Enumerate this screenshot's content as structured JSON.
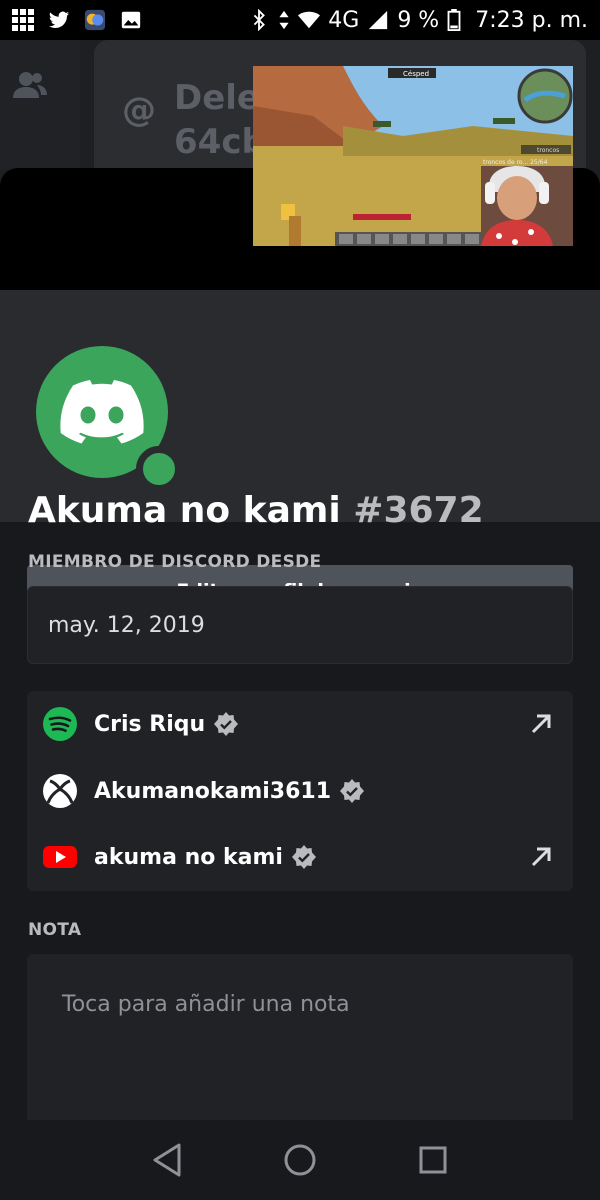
{
  "status_bar": {
    "network": "4G",
    "battery": "9 %",
    "time": "7:23 p. m."
  },
  "background": {
    "dm_title": "Delet\n64cb"
  },
  "profile": {
    "username": "Akuma no kami",
    "discriminator": "#3672",
    "edit_button_label": "Editar perfil de usuario",
    "status": "online",
    "avatar_color": "#3ba55c"
  },
  "member_since": {
    "label": "MIEMBRO DE DISCORD DESDE",
    "date": "may. 12, 2019"
  },
  "connected_accounts": [
    {
      "service": "spotify",
      "name": "Cris Riqu",
      "verified": true,
      "external_link": true
    },
    {
      "service": "xbox",
      "name": "Akumanokami3611",
      "verified": true,
      "external_link": false
    },
    {
      "service": "youtube",
      "name": "akuma no kami",
      "verified": true,
      "external_link": true
    }
  ],
  "note": {
    "label": "NOTA",
    "placeholder": "Toca para añadir una nota"
  },
  "pip_video": {
    "hud_item": "Césped",
    "hud_text": "troncos de ro... 25/64",
    "hud_tag": "troncos"
  },
  "colors": {
    "accent_green": "#3ba55c",
    "spotify": "#1db954",
    "youtube": "#ff0000",
    "button": "#4f545c"
  }
}
